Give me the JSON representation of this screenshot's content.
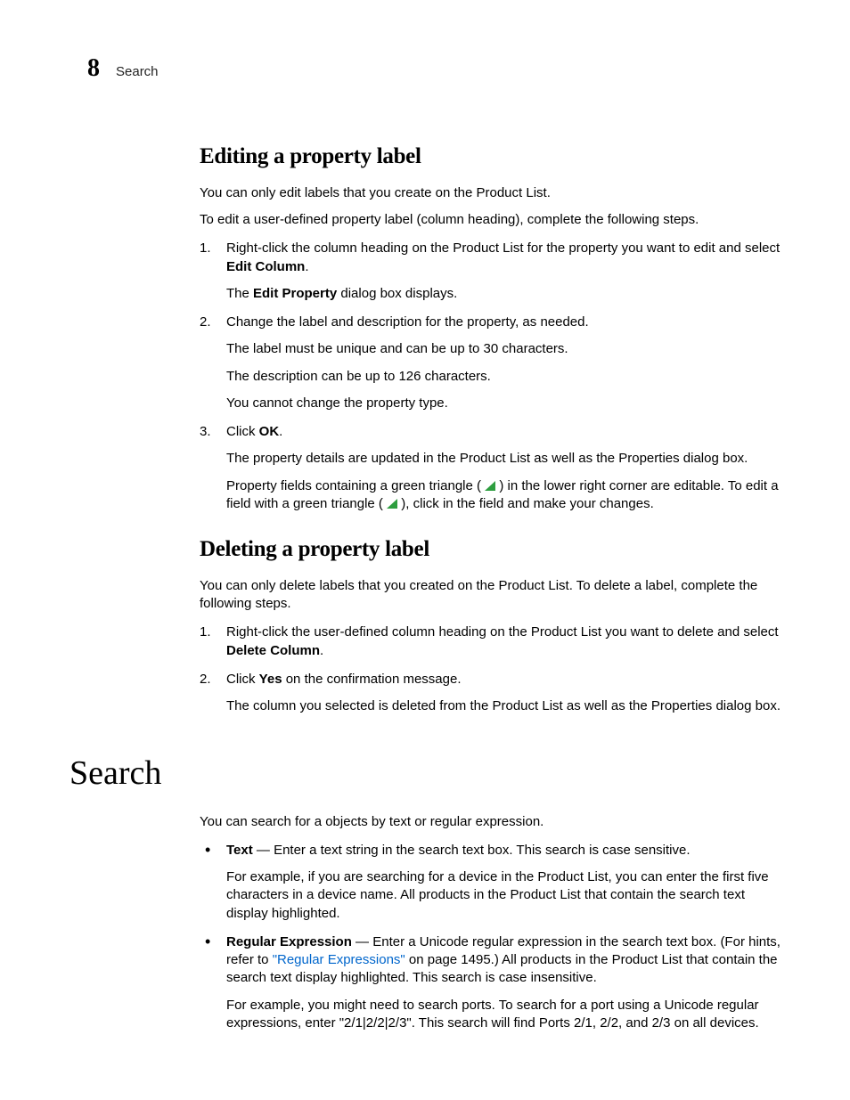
{
  "running_head": {
    "chapter_number": "8",
    "chapter_title": "Search"
  },
  "section1": {
    "heading": "Editing a property label",
    "intro1": "You can only edit labels that you create on the Product List.",
    "intro2": "To edit a user-defined property label (column heading), complete the following steps.",
    "steps": [
      {
        "num": "1.",
        "text_a": "Right-click the column heading on the Product List for the property you want to edit and select ",
        "bold_a": "Edit Column",
        "text_b": ".",
        "after1_a": "The ",
        "after1_bold": "Edit Property",
        "after1_b": " dialog box displays."
      },
      {
        "num": "2.",
        "text": "Change the label and description for the property, as needed.",
        "after1": "The label must be unique and can be up to 30 characters.",
        "after2": "The description can be up to 126 characters.",
        "after3": "You cannot change the property type."
      },
      {
        "num": "3.",
        "text_a": "Click ",
        "bold_a": "OK",
        "text_b": ".",
        "after1": "The property details are updated in the Product List as well as the Properties dialog box.",
        "after2_a": "Property fields containing a green triangle ( ",
        "after2_b": " ) in the lower right corner are editable. To edit a field with a green triangle ( ",
        "after2_c": " ), click in the field and make your changes."
      }
    ]
  },
  "section2": {
    "heading": "Deleting a property label",
    "intro": "You can only delete labels that you created on the Product List. To delete a label, complete the following steps.",
    "steps": [
      {
        "num": "1.",
        "text_a": "Right-click the user-defined column heading on the Product List you want to delete and select ",
        "bold_a": "Delete Column",
        "text_b": "."
      },
      {
        "num": "2.",
        "text_a": "Click ",
        "bold_a": "Yes",
        "text_b": " on the confirmation message.",
        "after1": "The column you selected is deleted from the Product List as well as the Properties dialog box."
      }
    ]
  },
  "section3": {
    "heading": "Search",
    "intro": "You can search for a objects by text or regular expression.",
    "bullets": [
      {
        "bold": "Text",
        "text": " — Enter a text string in the search text box. This search is case sensitive.",
        "after1": "For example, if you are searching for a device in the Product List, you can enter the first five characters in a device name. All products in the Product List that contain the search text display highlighted."
      },
      {
        "bold": "Regular Expression",
        "text_a": " — Enter a Unicode regular expression in the search text box. (For hints, refer to ",
        "link": "\"Regular Expressions\"",
        "text_b": " on page 1495.) All products in the Product List that contain the search text display highlighted. This search is case insensitive.",
        "after1": "For example, you might need to search ports. To search for a port using a Unicode regular expressions, enter \"2/1|2/2|2/3\". This search will find Ports 2/1, 2/2, and 2/3 on all devices."
      }
    ]
  }
}
